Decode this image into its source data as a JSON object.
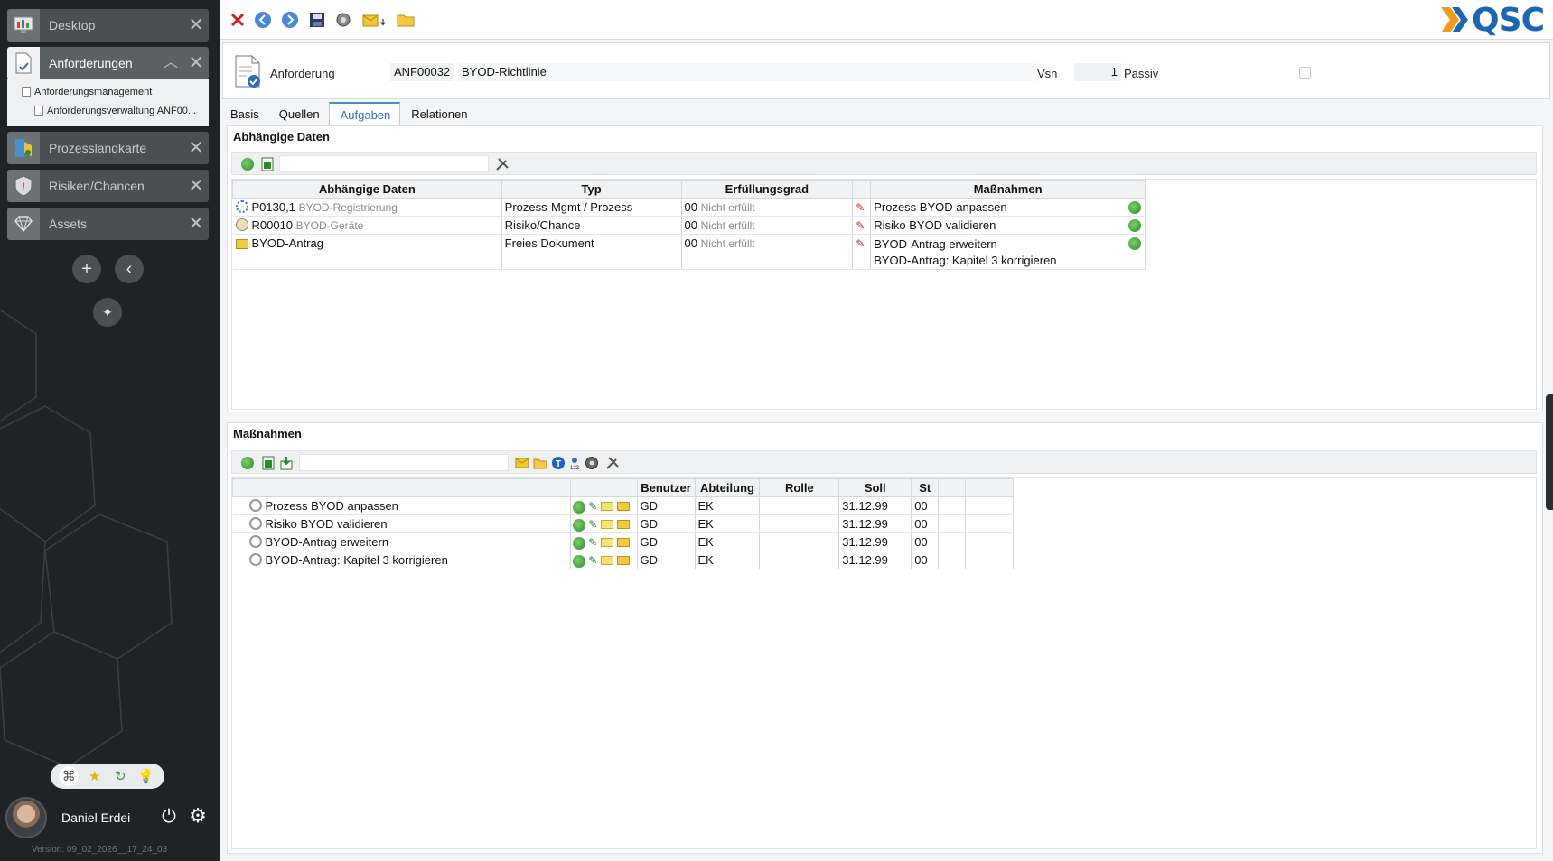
{
  "sidebar": {
    "items": [
      {
        "label": "Desktop"
      },
      {
        "label": "Anforderungen"
      },
      {
        "label": "Prozesslandkarte"
      },
      {
        "label": "Risiken/Chancen"
      },
      {
        "label": "Assets"
      }
    ],
    "sub_items": [
      "Anforderungsmanagement",
      "Anforderungsverwaltung ANF00..."
    ],
    "user_name": "Daniel Erdei",
    "version": "Version: 09_02_2026__17_24_03"
  },
  "logo_text": "QSC",
  "header": {
    "label": "Anforderung",
    "id": "ANF00032",
    "title": "BYOD-Richtlinie",
    "vsn_label": "Vsn",
    "vsn_value": "1",
    "passiv_label": "Passiv"
  },
  "tabs": [
    {
      "label": "Basis"
    },
    {
      "label": "Quellen"
    },
    {
      "label": "Aufgaben",
      "active": true
    },
    {
      "label": "Relationen"
    }
  ],
  "dependent": {
    "title": "Abhängige Daten",
    "columns": [
      "Abhängige Daten",
      "Typ",
      "Erfüllungsgrad",
      "",
      "Maßnahmen"
    ],
    "rows": [
      {
        "id": "P0130,1",
        "name": "BYOD-Registrierung",
        "typ": "Prozess-Mgmt / Prozess",
        "grad": "00",
        "grad_text": "Nicht erfüllt",
        "massnahmen": [
          "Prozess BYOD anpassen"
        ]
      },
      {
        "id": "R00010",
        "name": "BYOD-Geräte",
        "typ": "Risiko/Chance",
        "grad": "00",
        "grad_text": "Nicht erfüllt",
        "massnahmen": [
          "Risiko BYOD validieren"
        ]
      },
      {
        "id": "BYOD-Antrag",
        "name": "",
        "typ": "Freies Dokument",
        "grad": "00",
        "grad_text": "Nicht erfüllt",
        "massnahmen": [
          "BYOD-Antrag erweitern",
          "BYOD-Antrag: Kapitel 3 korrigieren"
        ]
      }
    ]
  },
  "measures": {
    "title": "Maßnahmen",
    "columns": [
      "",
      "",
      "Benutzer",
      "Abteilung",
      "Rolle",
      "Soll",
      "St",
      "",
      ""
    ],
    "rows": [
      {
        "name": "Prozess BYOD anpassen",
        "benutzer": "GD",
        "abteilung": "EK",
        "rolle": "",
        "soll": "31.12.99",
        "st": "00"
      },
      {
        "name": "Risiko BYOD validieren",
        "benutzer": "GD",
        "abteilung": "EK",
        "rolle": "",
        "soll": "31.12.99",
        "st": "00"
      },
      {
        "name": "BYOD-Antrag erweitern",
        "benutzer": "GD",
        "abteilung": "EK",
        "rolle": "",
        "soll": "31.12.99",
        "st": "00"
      },
      {
        "name": "BYOD-Antrag: Kapitel 3 korrigieren",
        "benutzer": "GD",
        "abteilung": "EK",
        "rolle": "",
        "soll": "31.12.99",
        "st": "00"
      }
    ]
  }
}
